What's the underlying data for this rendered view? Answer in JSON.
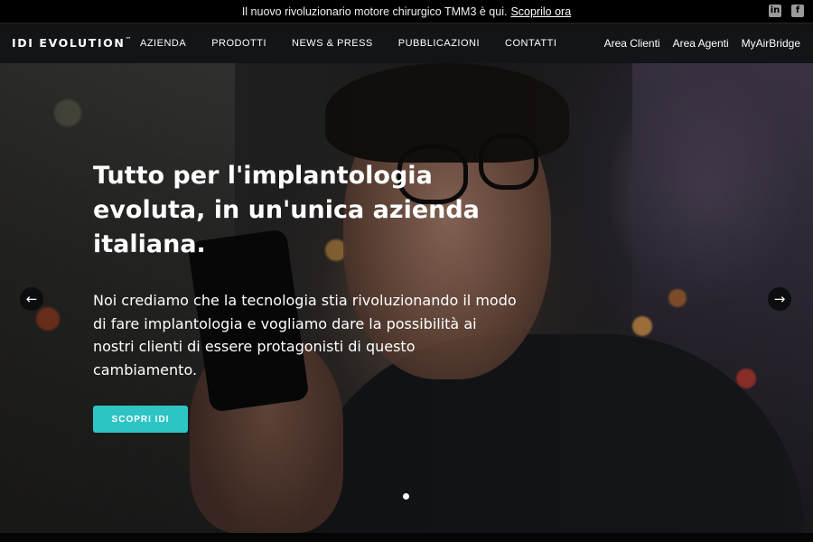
{
  "announcement": {
    "text": "Il nuovo rivoluzionario motore chirurgico TMM3 è qui.",
    "link_label": "Scoprilo ora",
    "social": [
      "linkedin-icon",
      "facebook-icon"
    ]
  },
  "header": {
    "logo": "IDI EVOLUTION",
    "logo_mark": "™",
    "menu": [
      "AZIENDA",
      "PRODOTTI",
      "NEWS & PRESS",
      "PUBBLICAZIONI",
      "CONTATTI"
    ],
    "right_links": [
      "Area Clienti",
      "Area Agenti",
      "MyAirBridge"
    ]
  },
  "hero": {
    "title": "Tutto per l'implantologia evoluta, in un'unica azienda italiana.",
    "body": "Noi crediamo che la tecnologia stia rivoluzionando il modo di fare implantologia e vogliamo dare la possibilità ai nostri clienti di essere protagonisti di questo cambiamento.",
    "cta_label": "SCOPRI IDI",
    "prev_arrow": "←",
    "next_arrow": "→",
    "slides_count": 1,
    "active_slide": 1
  },
  "colors": {
    "accent": "#2ec4c4",
    "nav_bg": "#121417",
    "topbar_bg": "#000000"
  }
}
